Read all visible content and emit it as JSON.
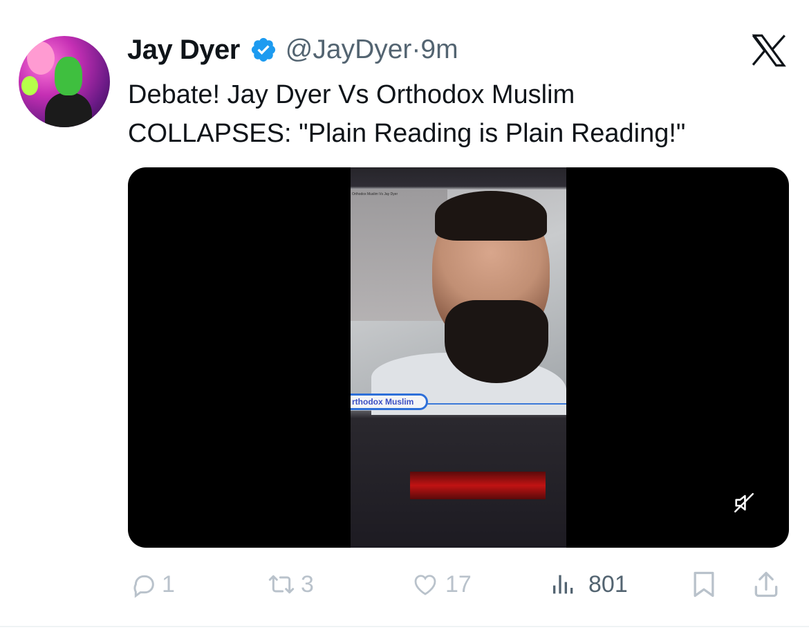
{
  "author": {
    "name": "Jay Dyer",
    "handle": "@JayDyer",
    "separator": "·",
    "time": "9m",
    "verified": true,
    "verified_color": "#1d9bf0"
  },
  "tweet": {
    "text_line1": "Debate! Jay Dyer Vs Orthodox Muslim",
    "text_line2": "COLLAPSES: \"Plain Reading is Plain Reading!\""
  },
  "video": {
    "caption": "rthodox Muslim",
    "tiny_title": "Orthodox Muslim Vs Jay Dyer",
    "muted": true
  },
  "actions": {
    "replies": "1",
    "reposts": "3",
    "likes": "17",
    "views": "801"
  },
  "icons": {
    "brand": "x-logo-icon",
    "verified": "verified-badge-icon",
    "mute": "mute-icon",
    "reply": "reply-icon",
    "repost": "repost-icon",
    "like": "heart-icon",
    "views": "views-icon",
    "bookmark": "bookmark-icon",
    "share": "share-icon"
  }
}
